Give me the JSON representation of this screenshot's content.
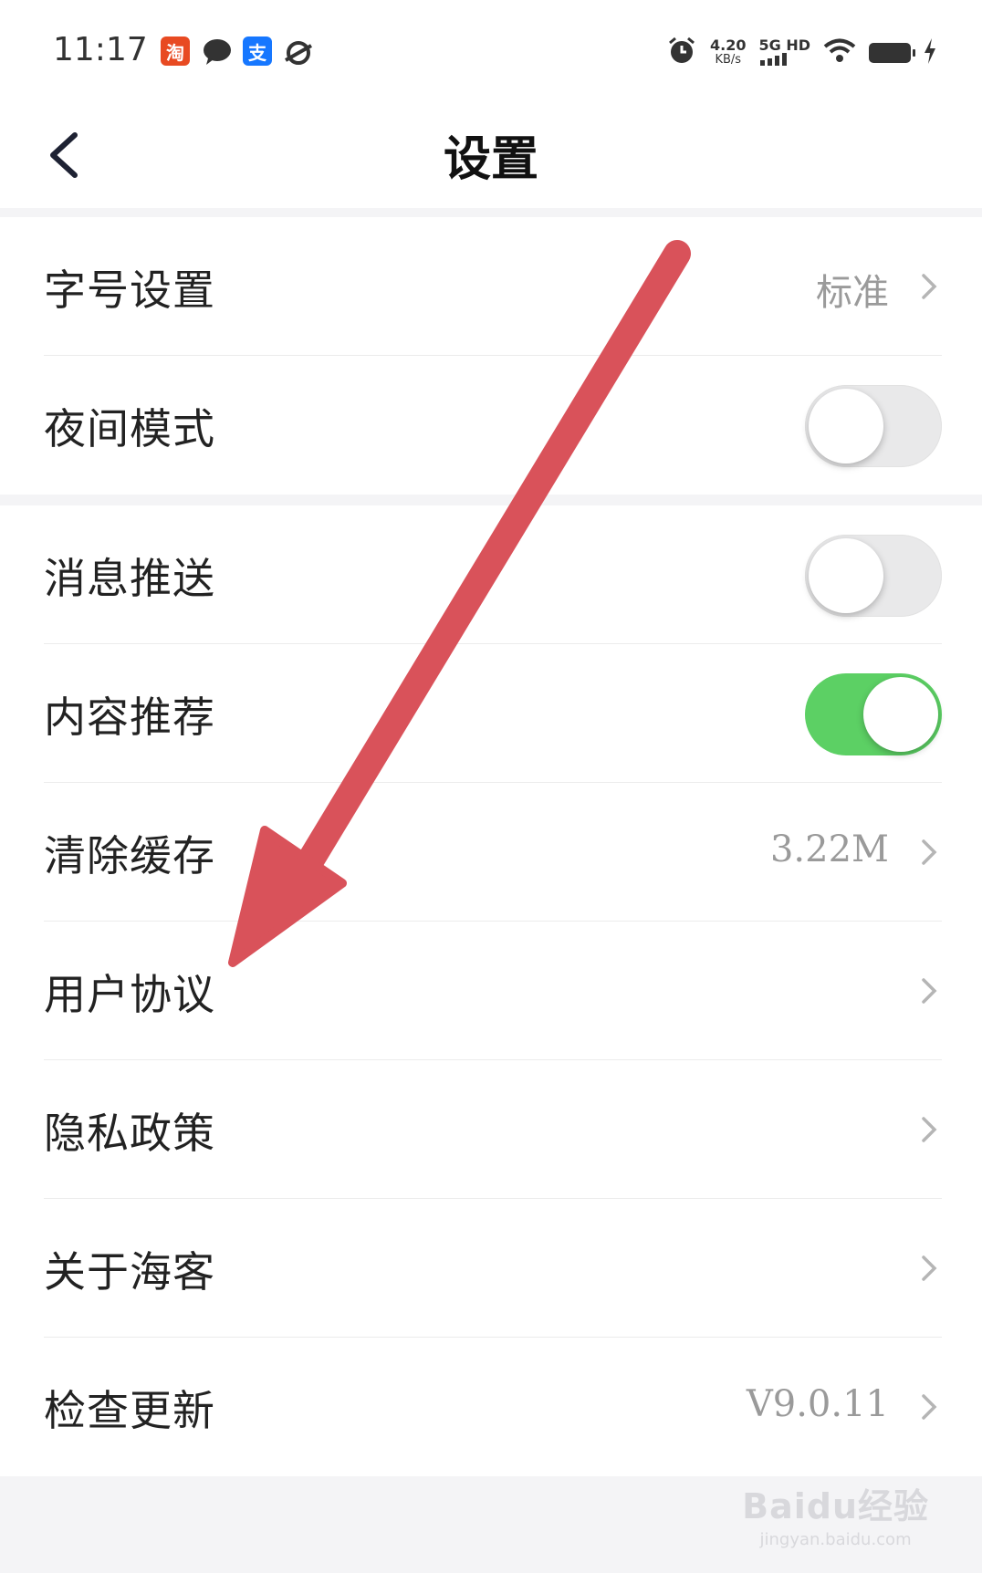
{
  "status_bar": {
    "time": "11:17",
    "apps": [
      {
        "icon": "taobao-app-icon",
        "glyph": "淘",
        "color": "#e84a22"
      },
      {
        "icon": "chat-bubble-icon",
        "glyph": "",
        "color": "#333333"
      },
      {
        "icon": "alipay-app-icon",
        "glyph": "支",
        "color": "#1677ff"
      },
      {
        "icon": "planet-app-icon",
        "glyph": "",
        "color": "#333333"
      }
    ],
    "speed_value": "4.20",
    "speed_unit": "KB/s",
    "network": "5G HD"
  },
  "nav": {
    "title": "设置",
    "back_icon": "chevron-left-icon"
  },
  "settings": {
    "font_size": {
      "label": "字号设置",
      "value": "标准"
    },
    "night_mode": {
      "label": "夜间模式",
      "on": false
    },
    "push": {
      "label": "消息推送",
      "on": false
    },
    "recommend": {
      "label": "内容推荐",
      "on": true
    },
    "clear_cache": {
      "label": "清除缓存",
      "value": "3.22M"
    },
    "user_agreement": {
      "label": "用户协议"
    },
    "privacy": {
      "label": "隐私政策"
    },
    "about": {
      "label": "关于海客"
    },
    "check_update": {
      "label": "检查更新",
      "value": "V9.0.11"
    }
  },
  "colors": {
    "toggle_on": "#5cd064",
    "annotation_arrow": "#d9525a"
  },
  "watermark": {
    "brand": "Baidu经验",
    "url": "jingyan.baidu.com"
  }
}
